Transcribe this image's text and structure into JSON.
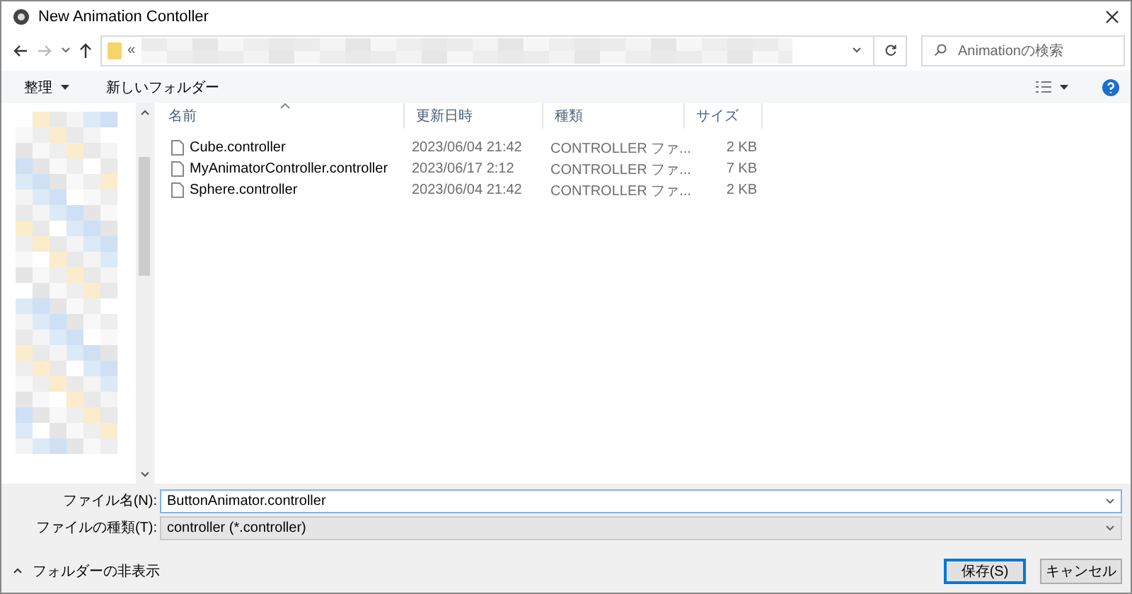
{
  "window": {
    "title": "New Animation Contoller"
  },
  "address": {
    "prefix": "«"
  },
  "search": {
    "placeholder": "Animationの検索"
  },
  "toolbar": {
    "organize": "整理",
    "new_folder": "新しいフォルダー"
  },
  "table": {
    "columns": [
      {
        "label": "名前",
        "sorted": true
      },
      {
        "label": "更新日時",
        "sorted": false
      },
      {
        "label": "種類",
        "sorted": false
      },
      {
        "label": "サイズ",
        "sorted": false
      }
    ],
    "rows": [
      {
        "name": "Cube.controller",
        "modified": "2023/06/04 21:42",
        "type": "CONTROLLER ファ...",
        "size": "2 KB"
      },
      {
        "name": "MyAnimatorController.controller",
        "modified": "2023/06/17 2:12",
        "type": "CONTROLLER ファ...",
        "size": "7 KB"
      },
      {
        "name": "Sphere.controller",
        "modified": "2023/06/04 21:42",
        "type": "CONTROLLER ファ...",
        "size": "2 KB"
      }
    ]
  },
  "form": {
    "file_name": {
      "label": "ファイル名(N):",
      "value": "ButtonAnimator.controller"
    },
    "file_type": {
      "label": "ファイルの種類(T):",
      "value": "controller (*.controller)"
    }
  },
  "footer": {
    "toggle": "フォルダーの非表示",
    "buttons": [
      {
        "label": "保存(S)",
        "default": true
      },
      {
        "label": "キャンセル",
        "default": false
      }
    ]
  }
}
